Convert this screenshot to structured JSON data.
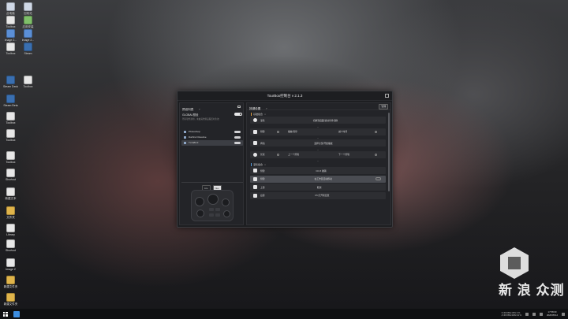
{
  "desktop": {
    "icons": [
      {
        "label": "此电脑",
        "color": "#cfd8e6"
      },
      {
        "label": "回收站",
        "color": "#cfd8e6"
      },
      {
        "label": "Toolbox",
        "color": "#e7e7e7"
      },
      {
        "label": "应用安装",
        "color": "#7fbf6a"
      },
      {
        "label": "Image 2...",
        "color": "#5b8fd6"
      },
      {
        "label": "Image 2...",
        "color": "#5b8fd6"
      },
      {
        "label": "Toolbox",
        "color": "#e7e7e7"
      },
      {
        "label": "Steam",
        "color": "#3a6fb0"
      },
      {
        "label": "Steam Deck",
        "color": "#3a6fb0"
      },
      {
        "label": "Steam Beta",
        "color": "#3a6fb0"
      },
      {
        "label": "Toolbox",
        "color": "#e7e7e7"
      },
      {
        "label": "Toolbox",
        "color": "#e7e7e7"
      },
      {
        "label": "Toolbox",
        "color": "#e7e7e7"
      },
      {
        "label": "Shortcut",
        "color": "#e7e7e7"
      },
      {
        "label": "新建文本",
        "color": "#e7e7e7"
      },
      {
        "label": "文件夹",
        "color": "#e0b44a"
      },
      {
        "label": "Library",
        "color": "#e7e7e7"
      },
      {
        "label": "Shortcut",
        "color": "#e7e7e7"
      },
      {
        "label": "Image 2",
        "color": "#e7e7e7"
      },
      {
        "label": "新建文件夹",
        "color": "#e0b44a"
      },
      {
        "label": "新建文件夹",
        "color": "#e0b44a"
      },
      {
        "label": "Toolbox",
        "color": "#e7e7e7"
      }
    ]
  },
  "window": {
    "title": "TourBox控制台 v 2.1.3"
  },
  "left_panel": {
    "title": "预设列表",
    "help": "?",
    "global": {
      "name": "GLOBAL预设",
      "desc": "所有软件通用，未被其他预设覆盖时生效"
    },
    "apps": [
      {
        "name": "Photoshop",
        "selected": false
      },
      {
        "name": "DaVinci Resolve",
        "selected": false
      },
      {
        "name": "TJ-WR-F",
        "selected": true
      }
    ],
    "tabs": [
      "Lite",
      "Neo"
    ],
    "active_tab": "Neo"
  },
  "right_panel": {
    "title": "按键设置",
    "help": "?",
    "manage_label": "管理",
    "groups": [
      {
        "name": "基础组合",
        "color": "#e0a040",
        "rows": [
          {
            "control": "滚轮",
            "icon": "round",
            "actions": [
              "切换到画面/滚动条件切换"
            ],
            "highlight": false
          },
          {
            "control": "侧键",
            "icon": "square",
            "actions": [
              "播放/暂停",
              "减少时间"
            ],
            "highlight": false
          },
          {
            "control": "拇指",
            "icon": "square",
            "actions": [
              "选择全部/开始播放"
            ],
            "highlight": false
          },
          {
            "control": "长按",
            "icon": "round",
            "actions": [
              "上一个剪辑",
              "下一个剪辑"
            ],
            "highlight": false
          }
        ]
      },
      {
        "name": "滚轮组合",
        "color": "#5aa0e0",
        "rows": [
          {
            "control": "侧键",
            "icon": "square",
            "actions": [
              "Ctrl Z 撤销"
            ],
            "highlight": false
          },
          {
            "control": "侧键",
            "icon": "square",
            "actions": [
              "在工作区自动移动"
            ],
            "highlight": true
          },
          {
            "control": "上键",
            "icon": "square",
            "actions": [
              "取消"
            ],
            "highlight": false
          },
          {
            "control": "后键",
            "icon": "square",
            "actions": [
              "F5 打开项目页"
            ],
            "highlight": false
          }
        ]
      }
    ]
  },
  "taskbar": {
    "stats_line1": "↑ 0.00 KB/s   CPU 0 %",
    "stats_line2": "↓ 0.00 KB/s   RAM 41 %",
    "time": "17:58:00",
    "date": "2020/05/12"
  },
  "watermark": {
    "text": "新 浪 众测"
  }
}
